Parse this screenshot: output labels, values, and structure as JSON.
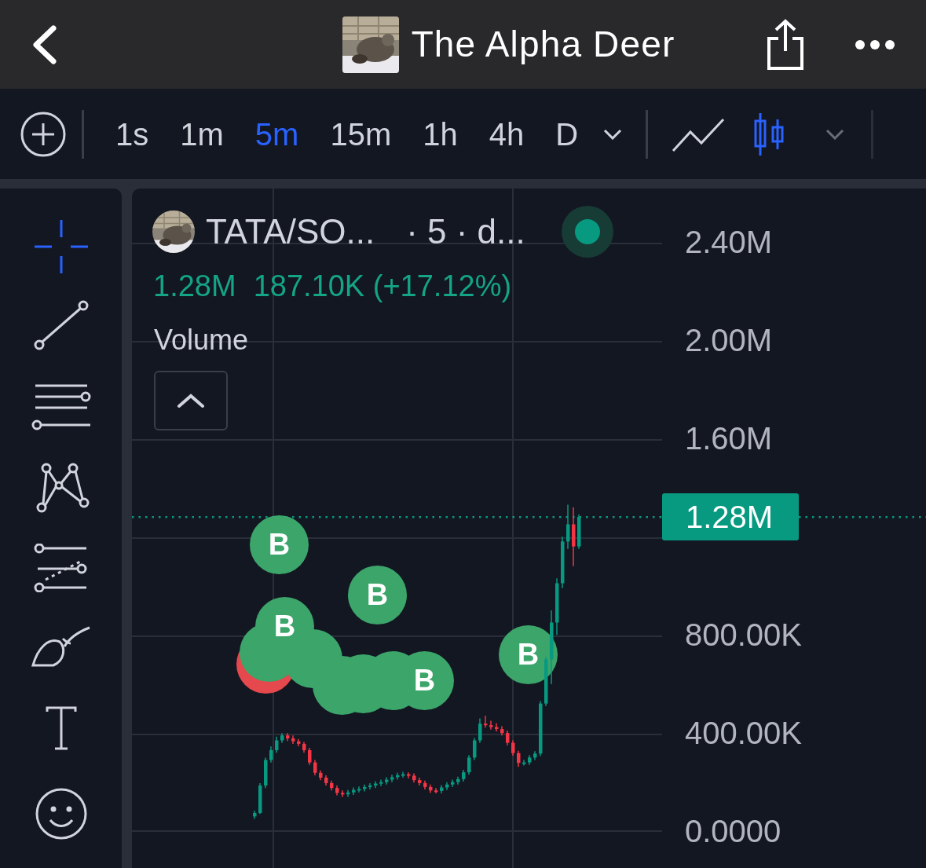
{
  "header": {
    "title": "The Alpha Deer"
  },
  "toolbar": {
    "timeframes": [
      {
        "label": "1s",
        "selected": false
      },
      {
        "label": "1m",
        "selected": false
      },
      {
        "label": "5m",
        "selected": true
      },
      {
        "label": "15m",
        "selected": false
      },
      {
        "label": "1h",
        "selected": false
      },
      {
        "label": "4h",
        "selected": false
      },
      {
        "label": "D",
        "selected": false
      }
    ],
    "chart_types": [
      {
        "kind": "line",
        "selected": false
      },
      {
        "kind": "candles",
        "selected": true
      }
    ]
  },
  "tools": [
    {
      "kind": "crosshair",
      "selected": true
    },
    {
      "kind": "trend-line",
      "selected": false
    },
    {
      "kind": "lines",
      "selected": false
    },
    {
      "kind": "pattern",
      "selected": false
    },
    {
      "kind": "channel",
      "selected": false
    },
    {
      "kind": "brush",
      "selected": false
    },
    {
      "kind": "text",
      "selected": false
    },
    {
      "kind": "emoji",
      "selected": false
    }
  ],
  "legend": {
    "symbol": "TATA/SO...",
    "interval": "· 5 · d...",
    "live": true,
    "last": "1.28M",
    "change": "187.10K (+17.12%)"
  },
  "indicator": {
    "name": "Volume"
  },
  "chart_data": {
    "type": "candlestick",
    "grid": true,
    "ylim": [
      -150000,
      2618000
    ],
    "ohlc": [
      [
        60000,
        84000,
        50000,
        74000
      ],
      [
        74000,
        196000,
        70000,
        186000
      ],
      [
        186000,
        300000,
        176000,
        290000
      ],
      [
        290000,
        345000,
        280000,
        330000
      ],
      [
        330000,
        385000,
        320000,
        370000
      ],
      [
        370000,
        400000,
        360000,
        390000
      ],
      [
        390000,
        400000,
        368000,
        378000
      ],
      [
        378000,
        390000,
        356000,
        366000
      ],
      [
        366000,
        376000,
        346000,
        356000
      ],
      [
        356000,
        364000,
        320000,
        330000
      ],
      [
        330000,
        340000,
        270000,
        280000
      ],
      [
        280000,
        290000,
        228000,
        238000
      ],
      [
        238000,
        248000,
        208000,
        218000
      ],
      [
        218000,
        228000,
        186000,
        196000
      ],
      [
        196000,
        206000,
        166000,
        176000
      ],
      [
        176000,
        186000,
        146000,
        156000
      ],
      [
        156000,
        166000,
        140000,
        150000
      ],
      [
        150000,
        168000,
        140000,
        158000
      ],
      [
        158000,
        178000,
        148000,
        168000
      ],
      [
        168000,
        182000,
        158000,
        172000
      ],
      [
        172000,
        190000,
        162000,
        180000
      ],
      [
        180000,
        196000,
        170000,
        186000
      ],
      [
        186000,
        204000,
        176000,
        194000
      ],
      [
        194000,
        210000,
        184000,
        200000
      ],
      [
        200000,
        220000,
        190000,
        210000
      ],
      [
        210000,
        230000,
        200000,
        220000
      ],
      [
        220000,
        238000,
        210000,
        228000
      ],
      [
        228000,
        242000,
        218000,
        232000
      ],
      [
        232000,
        240000,
        216000,
        226000
      ],
      [
        226000,
        236000,
        198000,
        208000
      ],
      [
        208000,
        218000,
        186000,
        196000
      ],
      [
        196000,
        206000,
        170000,
        180000
      ],
      [
        180000,
        190000,
        156000,
        166000
      ],
      [
        166000,
        176000,
        154000,
        164000
      ],
      [
        164000,
        188000,
        154000,
        178000
      ],
      [
        178000,
        200000,
        168000,
        190000
      ],
      [
        190000,
        210000,
        180000,
        200000
      ],
      [
        200000,
        222000,
        190000,
        212000
      ],
      [
        212000,
        250000,
        202000,
        240000
      ],
      [
        240000,
        310000,
        230000,
        300000
      ],
      [
        300000,
        380000,
        290000,
        370000
      ],
      [
        370000,
        460000,
        360000,
        438000
      ],
      [
        438000,
        470000,
        422000,
        432000
      ],
      [
        432000,
        450000,
        414000,
        424000
      ],
      [
        424000,
        440000,
        406000,
        416000
      ],
      [
        416000,
        428000,
        390000,
        400000
      ],
      [
        400000,
        410000,
        350000,
        360000
      ],
      [
        360000,
        370000,
        308000,
        318000
      ],
      [
        318000,
        328000,
        262000,
        278000
      ],
      [
        278000,
        290000,
        268000,
        280000
      ],
      [
        280000,
        310000,
        270000,
        300000
      ],
      [
        300000,
        326000,
        290000,
        316000
      ],
      [
        316000,
        530000,
        306000,
        520000
      ],
      [
        520000,
        710000,
        510000,
        700000
      ],
      [
        700000,
        900000,
        600000,
        850000
      ],
      [
        850000,
        1030000,
        800000,
        1010000
      ],
      [
        1010000,
        1200000,
        990000,
        1180000
      ],
      [
        1180000,
        1330000,
        1150000,
        1250000
      ],
      [
        1250000,
        1320000,
        1080000,
        1160000
      ],
      [
        1160000,
        1290000,
        1150000,
        1280000
      ]
    ],
    "yticks": [
      {
        "value": 2400000,
        "label": "2.40M"
      },
      {
        "value": 2000000,
        "label": "2.00M"
      },
      {
        "value": 1600000,
        "label": "1.60M"
      },
      {
        "value": 800000,
        "label": "800.00K"
      },
      {
        "value": 400000,
        "label": "400.00K"
      },
      {
        "value": 0,
        "label": "0.0000"
      }
    ],
    "ref_lines": [
      {
        "axis": "y",
        "value": 1280000,
        "label": "1.28M",
        "color": "#089981"
      }
    ]
  },
  "markers": [
    {
      "color": "#e5484d"
    },
    {
      "color": "#3ba56a"
    },
    {
      "color": "#3ba56a"
    },
    {
      "color": "#3ba56a"
    },
    {
      "color": "#3ba56a"
    },
    {
      "color": "#3ba56a"
    },
    {
      "color": "#3ba56a",
      "label": "B"
    },
    {
      "color": "#3ba56a",
      "label": "B"
    },
    {
      "color": "#3ba56a",
      "label": "B"
    },
    {
      "color": "#3ba56a",
      "label": "B"
    },
    {
      "color": "#3ba56a",
      "label": "B"
    }
  ]
}
